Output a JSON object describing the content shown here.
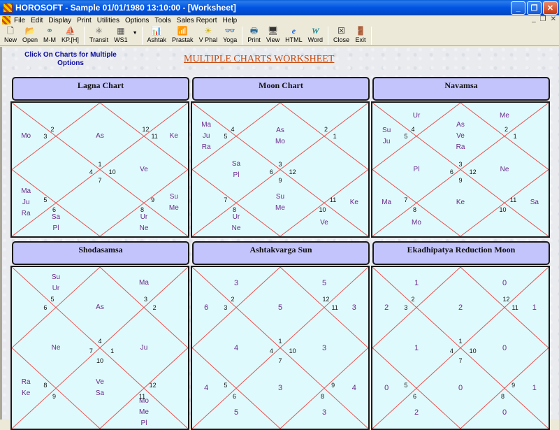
{
  "window": {
    "title": "HOROSOFT -  Sample 01/01/1980 13:10:00 - [Worksheet]",
    "buttons": [
      "minimize",
      "restore",
      "close"
    ]
  },
  "menu": [
    "File",
    "Edit",
    "Display",
    "Print",
    "Utilities",
    "Options",
    "Tools",
    "Sales Report",
    "Help"
  ],
  "toolbar": [
    {
      "label": "New",
      "icon": "new-document-icon",
      "glyph": "🗋"
    },
    {
      "label": "Open",
      "icon": "open-folder-icon",
      "glyph": "📂"
    },
    {
      "label": "M-M",
      "icon": "match-making-icon",
      "glyph": "⚭"
    },
    {
      "label": "KP.[H]",
      "icon": "kp-icon",
      "glyph": "⛵"
    },
    {
      "sep": true
    },
    {
      "label": "Transit",
      "icon": "transit-icon",
      "glyph": "⚛"
    },
    {
      "label": "WS1",
      "icon": "worksheet-icon",
      "glyph": "▦",
      "dropdown": true
    },
    {
      "sep": true
    },
    {
      "label": "Ashtak",
      "icon": "ashtak-icon",
      "glyph": "📊"
    },
    {
      "label": "Prastak",
      "icon": "prastak-icon",
      "glyph": "📶"
    },
    {
      "label": "V Phal",
      "icon": "vphal-icon",
      "glyph": "☀"
    },
    {
      "label": "Yoga",
      "icon": "yoga-icon",
      "glyph": "👓"
    },
    {
      "sep": true
    },
    {
      "label": "Print",
      "icon": "printer-icon",
      "glyph": "🖶"
    },
    {
      "label": "View",
      "icon": "monitor-icon",
      "glyph": "🖥"
    },
    {
      "label": "HTML",
      "icon": "internet-explorer-icon",
      "glyph": "e"
    },
    {
      "label": "Word",
      "icon": "word-icon",
      "glyph": "W"
    },
    {
      "sep": true
    },
    {
      "label": "Close",
      "icon": "close-window-icon",
      "glyph": "☒"
    },
    {
      "label": "Exit",
      "icon": "exit-door-icon",
      "glyph": "🚪"
    },
    {
      "sep": true
    }
  ],
  "hint": "Click On Charts for Multiple Options",
  "page_title": "MULTIPLE CHARTS WORKSHEET",
  "charts": [
    {
      "title": "Lagna Chart",
      "houses": [
        "1",
        "2",
        "3",
        "4",
        "5",
        "6",
        "7",
        "8",
        "9",
        "10",
        "11",
        "12"
      ],
      "house_numbers": {
        "h1": "1",
        "h2": "2",
        "h3": "3",
        "h4": "4",
        "h5": "5",
        "h6": "6",
        "h7": "7",
        "h8": "8",
        "h9": "9",
        "h10": "10",
        "h11": "11",
        "h12": "12"
      },
      "house_signs": [
        1,
        2,
        3,
        4,
        5,
        6,
        7,
        8,
        9,
        10,
        11,
        12
      ],
      "contents": [
        "As",
        "",
        "Mo",
        "",
        "Ma\nJu\nRa",
        "Sa\nPl",
        "",
        "Ur\nNe",
        "Su\nMe",
        "Ve",
        "Ke",
        ""
      ]
    },
    {
      "title": "Moon Chart",
      "house_signs": [
        3,
        4,
        5,
        6,
        7,
        8,
        9,
        10,
        11,
        12,
        1,
        2
      ],
      "contents": [
        "As\nMo",
        "",
        "Ma\nJu\nRa",
        "Sa\nPl",
        "",
        "Ur\nNe",
        "Su\nMe",
        "Ve",
        "Ke",
        "",
        "",
        ""
      ]
    },
    {
      "title": "Navamsa",
      "house_signs": [
        3,
        4,
        5,
        6,
        7,
        8,
        9,
        10,
        11,
        12,
        1,
        2
      ],
      "contents": [
        "As\nVe\nRa",
        "Ur",
        "Su\nJu",
        "Pl",
        "Ma",
        "Mo",
        "Ke",
        "",
        "Sa",
        "Ne",
        "",
        "Me"
      ]
    },
    {
      "title": "Shodasamsa",
      "house_signs": [
        4,
        5,
        6,
        7,
        8,
        9,
        10,
        11,
        12,
        1,
        2,
        3
      ],
      "contents": [
        "As",
        "Su\nUr",
        "",
        "Ne",
        "Ra\nKe",
        "",
        "Ve\nSa",
        "Mo\nMe\nPl",
        "",
        "Ju",
        "",
        "Ma"
      ]
    },
    {
      "title": "Ashtakvarga Sun",
      "house_signs": [
        1,
        2,
        3,
        4,
        5,
        6,
        7,
        8,
        9,
        10,
        11,
        12
      ],
      "contents": [
        "5",
        "3",
        "6",
        "4",
        "4",
        "5",
        "3",
        "3",
        "4",
        "3",
        "3",
        "5"
      ],
      "numeric": true
    },
    {
      "title": "Ekadhipatya Reduction Moon",
      "house_signs": [
        1,
        2,
        3,
        4,
        5,
        6,
        7,
        8,
        9,
        10,
        11,
        12
      ],
      "contents": [
        "2",
        "1",
        "2",
        "1",
        "0",
        "2",
        "0",
        "0",
        "1",
        "0",
        "1",
        "0"
      ],
      "numeric": true
    }
  ]
}
